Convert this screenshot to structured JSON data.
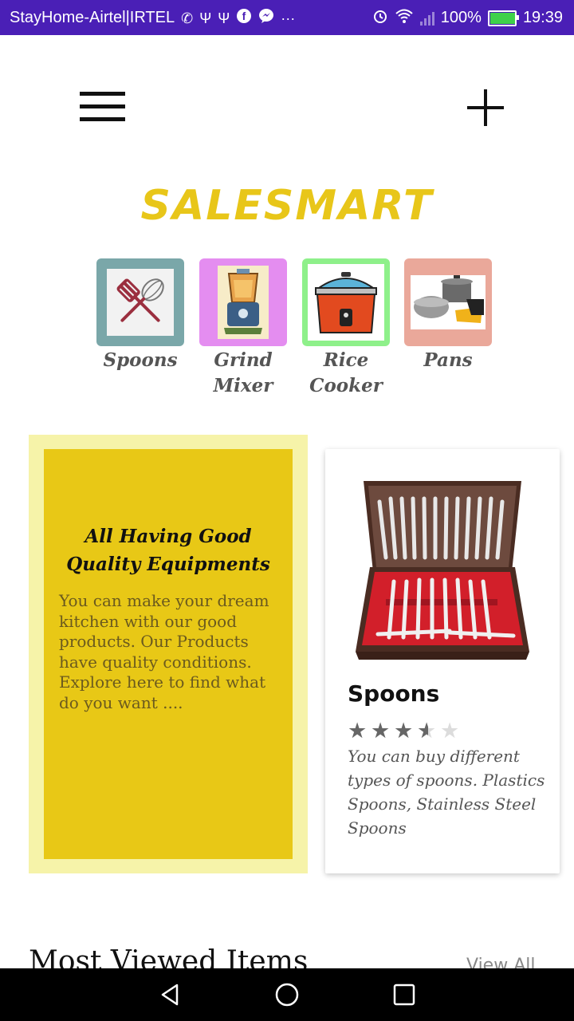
{
  "status_bar": {
    "carrier": "StayHome-Airtel|IRTEL",
    "notif_icons": [
      "phone-icon",
      "usb-icon",
      "usb-icon",
      "facebook-icon",
      "messenger-icon",
      "more-icon"
    ],
    "more": "···",
    "battery_percent": "100%",
    "battery_level": 1.0,
    "time": "19:39"
  },
  "header": {
    "brand": "SALESMART"
  },
  "categories": [
    {
      "label": "Spoons",
      "border": "#7aa7a9"
    },
    {
      "label": "Grind Mixer",
      "border": "#e48df0"
    },
    {
      "label": "Rice Cooker",
      "border": "#8ef08a"
    },
    {
      "label": "Pans",
      "border": "#eaa89a"
    }
  ],
  "promo": {
    "title": "All Having Good Quality Equipments",
    "text": "You can make your dream kitchen with our good products. Our Products have quality conditions. Explore here to find what do you want ...."
  },
  "product": {
    "title": "Spoons",
    "rating": 3.5,
    "rating_max": 5,
    "description": "You can buy different types of spoons. Plastics Spoons, Stainless Steel Spoons"
  },
  "most_viewed": {
    "title": "Most Viewed Items",
    "view_all": "View All"
  },
  "colors": {
    "status_bar": "#4a1fb6",
    "brand": "#e8c619",
    "promo_bg": "#e8c816",
    "promo_outer": "#f6f3a9"
  }
}
